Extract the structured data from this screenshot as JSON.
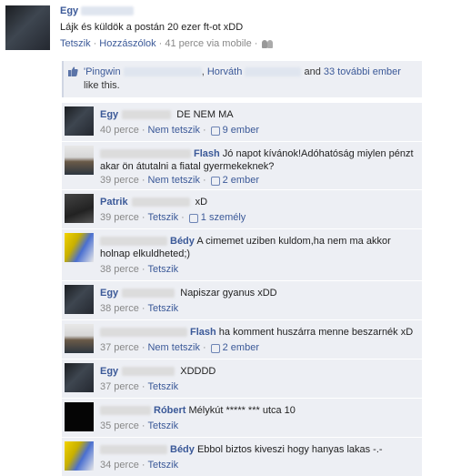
{
  "post": {
    "author": "Egy",
    "message": "Lájk és küldök a postán 20 ezer ft-ot xDD",
    "like_link": "Tetszik",
    "comment_link": "Hozzászólok",
    "time": "41 perce via mobile",
    "sep": "·"
  },
  "likes": {
    "name1": "'Pingwin",
    "name2": "Horváth",
    "sep": ",",
    "and": "and",
    "others": "33 további ember",
    "tail": "like this."
  },
  "comments": [
    {
      "name": "Egy",
      "text": "DE NEM MA",
      "time": "40 perce",
      "like": "Nem tetszik",
      "count": "9 ember"
    },
    {
      "name": "Flash",
      "text": "Jó napot kívánok!Adóhatóság miylen pénzt akar ön átutalni a fiatal gyermekeknek?",
      "time": "39 perce",
      "like": "Nem tetszik",
      "count": "2 ember"
    },
    {
      "name": "Patrik",
      "text": "xD",
      "time": "39 perce",
      "like": "Tetszik",
      "count": "1 személy"
    },
    {
      "name": "Bédy",
      "text": "A cimemet uziben kuldom,ha nem ma akkor holnap elkuldheted;)",
      "time": "38 perce",
      "like": "Tetszik",
      "count": ""
    },
    {
      "name": "Egy",
      "text": "Napiszar gyanus xDD",
      "time": "38 perce",
      "like": "Tetszik",
      "count": ""
    },
    {
      "name": "Flash",
      "text": "ha komment huszárra menne beszarnék xD",
      "time": "37 perce",
      "like": "Nem tetszik",
      "count": "2 ember"
    },
    {
      "name": "Egy",
      "text": "XDDDD",
      "time": "37 perce",
      "like": "Tetszik",
      "count": ""
    },
    {
      "name": "Róbert",
      "text": "Mélykút ***** *** utca 10",
      "time": "35 perce",
      "like": "Tetszik",
      "count": ""
    },
    {
      "name": "Bédy",
      "text": "Ebbol biztos kiveszi hogy hanyas lakas -.-",
      "time": "34 perce",
      "like": "Tetszik",
      "count": ""
    }
  ],
  "meta_sep": "·",
  "colors": {
    "link": "#3b5998",
    "ufi_bg": "#edeff4",
    "meta": "#888888"
  }
}
